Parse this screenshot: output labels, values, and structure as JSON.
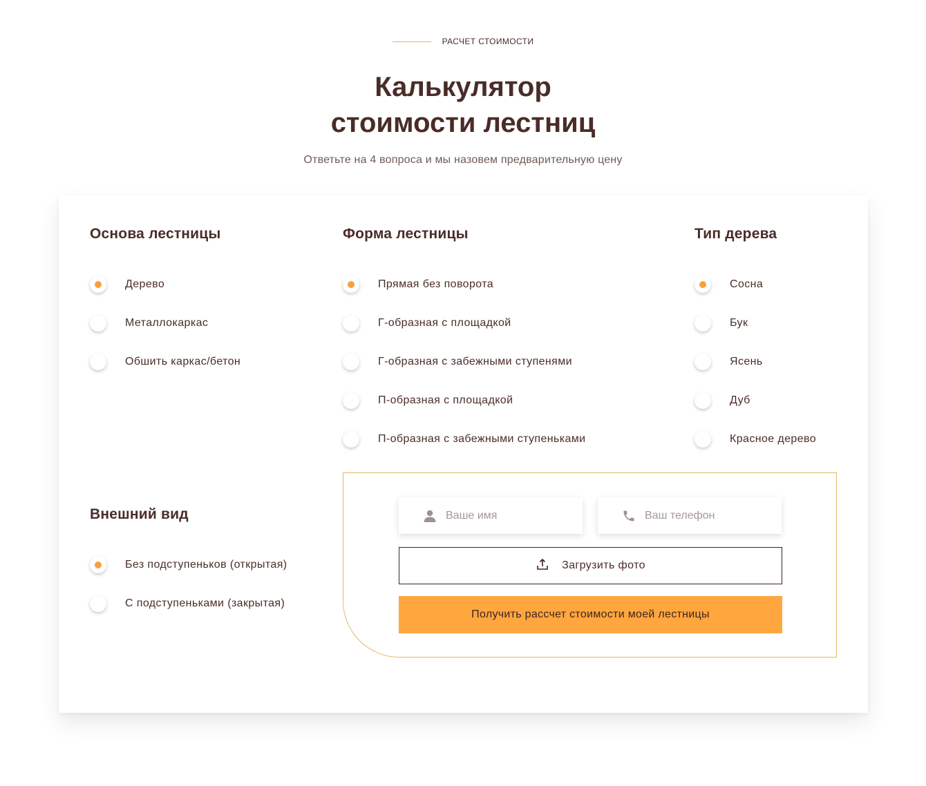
{
  "header": {
    "eyebrow": "РАСЧЕТ СТОИМОСТИ",
    "title_line1": "Калькулятор",
    "title_line2": "стоимости лестниц",
    "subtitle": "Ответьте на 4 вопроса и мы назовем предварительную цену"
  },
  "groups": {
    "base": {
      "title": "Основа лестницы",
      "options": [
        "Дерево",
        "Металлокаркас",
        "Обшить каркас/бетон"
      ],
      "selected": "Дерево"
    },
    "shape": {
      "title": "Форма лестницы",
      "options": [
        "Прямая без поворота",
        "Г-образная с площадкой",
        "Г-образная с забежными ступенями",
        "П-образная с площадкой",
        "П-образная с забежными ступеньками"
      ],
      "selected": "Прямая без поворота"
    },
    "wood": {
      "title": "Тип дерева",
      "options": [
        "Сосна",
        "Бук",
        "Ясень",
        "Дуб",
        "Красное дерево"
      ],
      "selected": "Сосна"
    },
    "look": {
      "title": "Внешний вид",
      "options": [
        "Без подступеньков (открытая)",
        "С подступеньками (закрытая)"
      ],
      "selected": "Без подступеньков (открытая)"
    }
  },
  "form": {
    "name_placeholder": "Ваше имя",
    "phone_placeholder": "Ваш телефон",
    "upload_label": "Загрузить фото",
    "submit_label": "Получить рассчет стоимости моей лестницы"
  },
  "icons": {
    "name": "user-icon",
    "phone": "phone-icon",
    "upload": "upload-icon"
  },
  "colors": {
    "accent": "#ffa63e",
    "radio_dot": "#f5a23c",
    "border_gold": "#e3b866",
    "text_brown": "#4a2c27"
  }
}
